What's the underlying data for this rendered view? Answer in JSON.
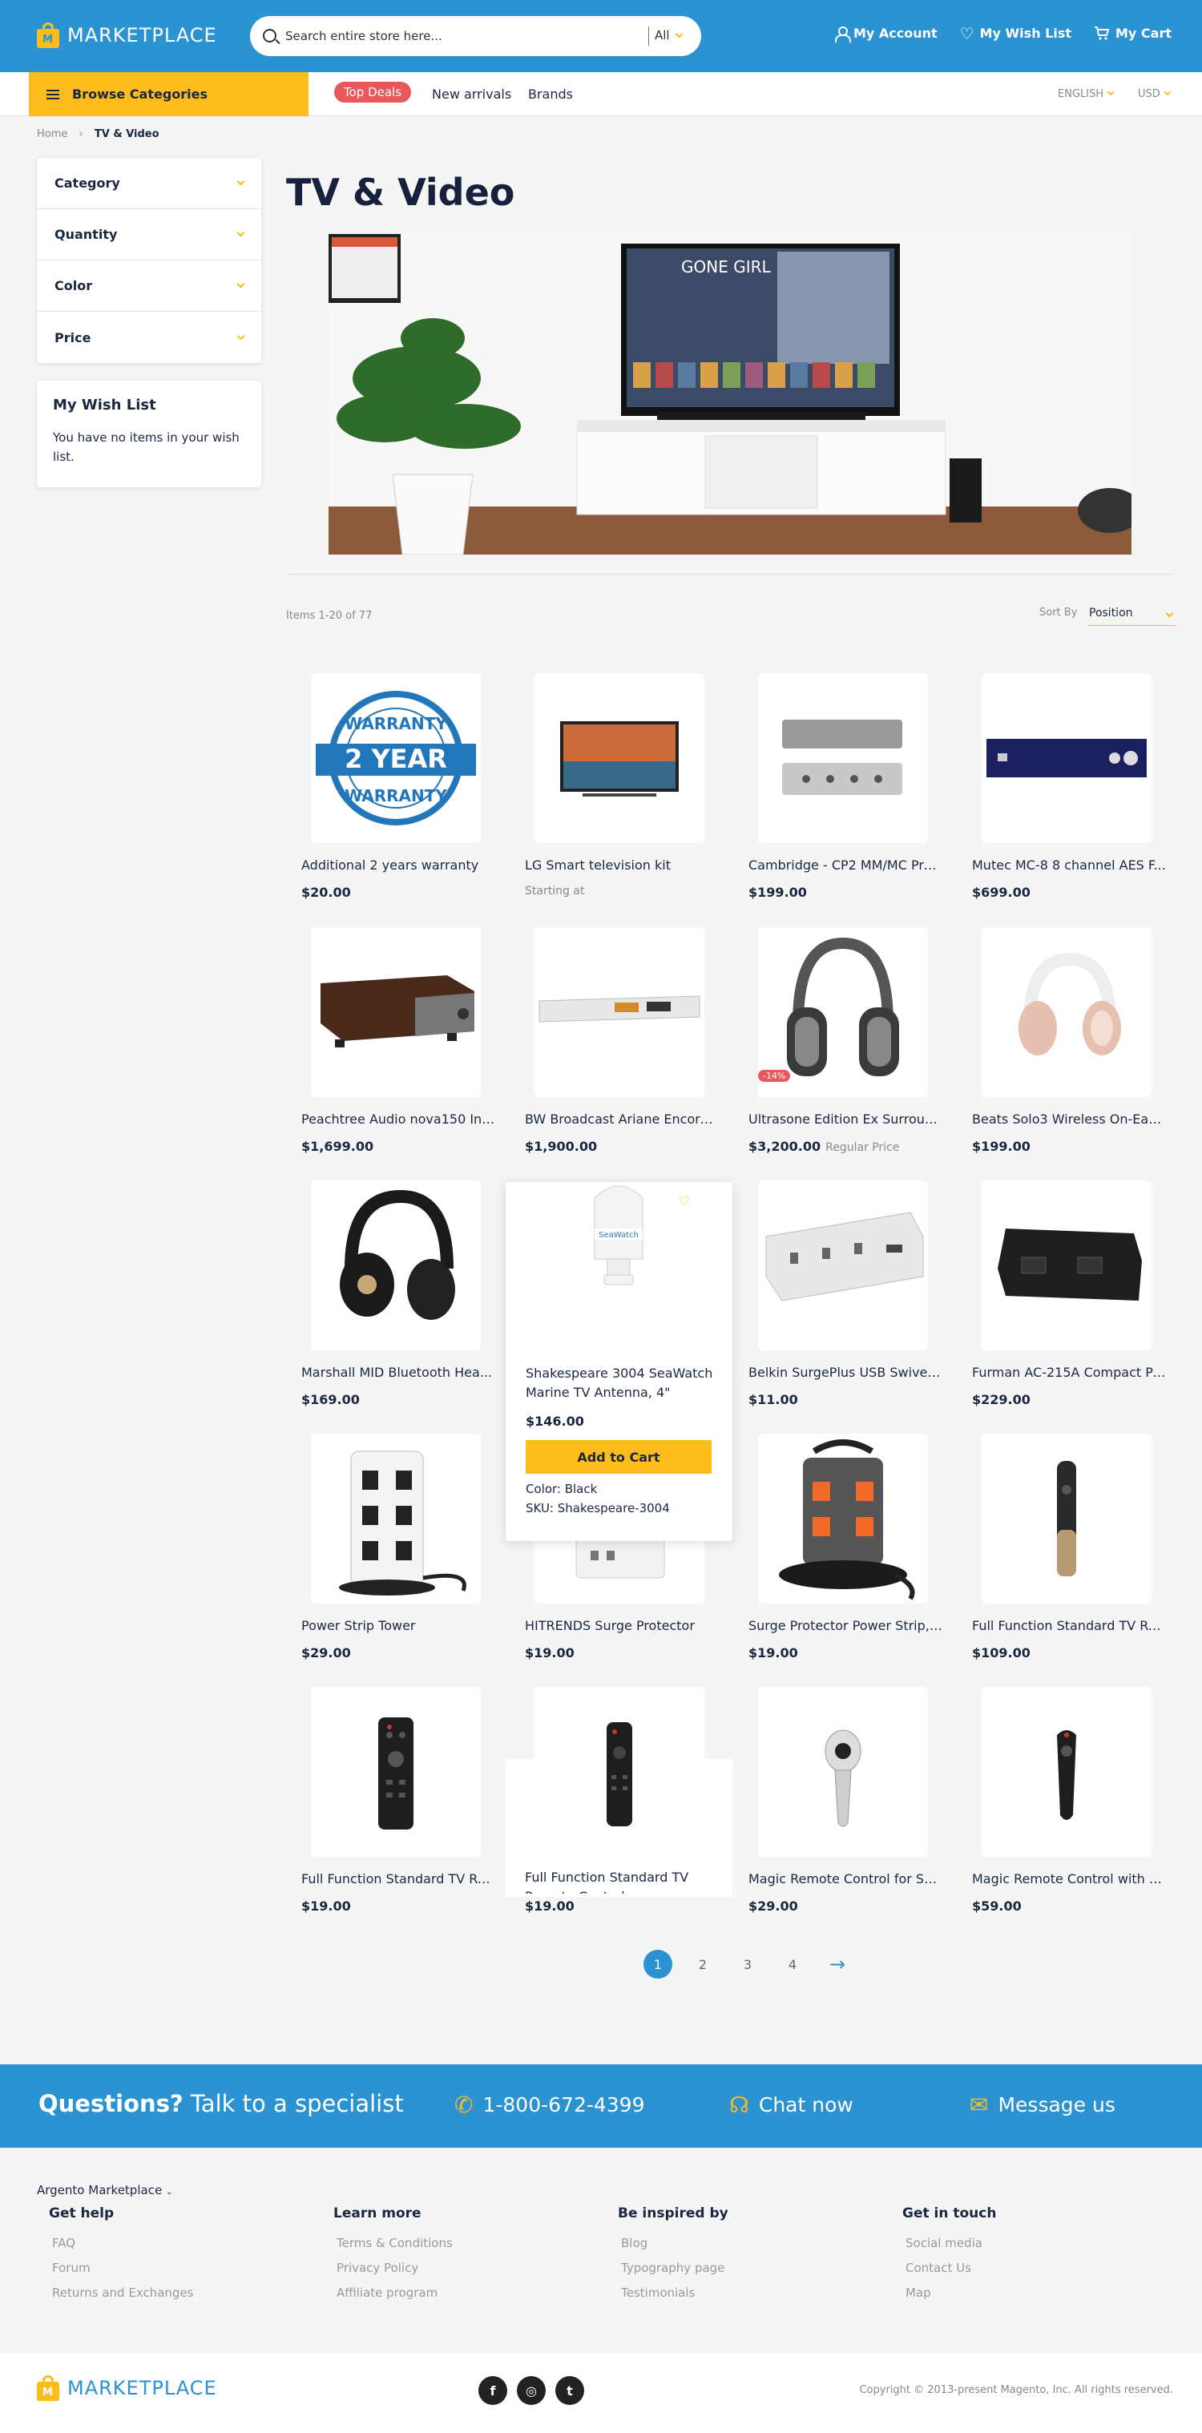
{
  "header": {
    "logo_text": "MARKETPLACE",
    "logo_letter": "M",
    "search_placeholder": "Search entire store here...",
    "search_scope": "All",
    "my_account": "My Account",
    "my_wishlist": "My Wish List",
    "my_cart": "My Cart"
  },
  "nav": {
    "browse": "Browse Categories",
    "top_deals": "Top Deals",
    "new_arrivals": "New arrivals",
    "brands": "Brands",
    "language": "ENGLISH",
    "currency": "USD"
  },
  "breadcrumb": {
    "home": "Home",
    "sep": "›",
    "current": "TV & Video"
  },
  "filters": [
    "Category",
    "Quantity",
    "Color",
    "Price"
  ],
  "wishlist": {
    "title": "My Wish List",
    "empty": "You have no items in your wish list."
  },
  "page_title": "TV & Video",
  "banner": {
    "movie_title": "GONE GIRL"
  },
  "toolbar": {
    "items_count": "Items 1-20 of 77",
    "sort_label": "Sort By",
    "sort_value": "Position"
  },
  "products": [
    {
      "name": "Additional 2 years warranty",
      "price": "$20.00",
      "icon": "warranty-badge"
    },
    {
      "name": "LG Smart television kit",
      "price": "",
      "note": "Starting at",
      "icon": "tv"
    },
    {
      "name": "Cambridge - CP2 MM/MC Pre...",
      "price": "$199.00",
      "icon": "preamp"
    },
    {
      "name": "Mutec MC-8 8 channel AES F...",
      "price": "$699.00",
      "icon": "rack-unit"
    },
    {
      "name": "Peachtree Audio nova150 Int...",
      "price": "$1,699.00",
      "icon": "amplifier"
    },
    {
      "name": "BW Broadcast Ariane Encore ...",
      "price": "$1,900.00",
      "icon": "rack-unit-white"
    },
    {
      "name": "Ultrasone Edition Ex Surroun...",
      "price": "$3,200.00",
      "regular": "Regular Price",
      "badge": "-14%",
      "icon": "headphones"
    },
    {
      "name": "Beats Solo3 Wireless On-Ear ...",
      "price": "$199.00",
      "icon": "headphones-rose"
    },
    {
      "name": "Marshall MID Bluetooth Hea...",
      "price": "$169.00",
      "icon": "headphones-black"
    },
    {
      "name": "Shakespeare 3004 SeaWatch Marine TV Antenna, 4\"",
      "price": "$146.00",
      "icon": "antenna"
    },
    {
      "name": "Belkin SurgePlus USB Swivel ...",
      "price": "$11.00",
      "icon": "surge-protector"
    },
    {
      "name": "Furman AC-215A Compact Po...",
      "price": "$229.00",
      "icon": "power-conditioner"
    },
    {
      "name": "Power Strip Tower",
      "price": "$29.00",
      "icon": "power-tower"
    },
    {
      "name": "HITRENDS Surge Protector",
      "price": "$19.00",
      "icon": "wall-outlet"
    },
    {
      "name": "Surge Protector Power Strip, ...",
      "price": "$19.00",
      "icon": "power-tower-orange"
    },
    {
      "name": "Full Function Standard TV Re...",
      "price": "$109.00",
      "icon": "remote-gold"
    },
    {
      "name": "Full Function Standard TV Re...",
      "price": "$19.00",
      "icon": "remote"
    },
    {
      "name": "Full Function Standard TV Remote Control",
      "price": "$19.00",
      "icon": "remote"
    },
    {
      "name": "Magic Remote Control for SE...",
      "price": "$29.00",
      "icon": "magic-remote"
    },
    {
      "name": "Magic Remote Control with V...",
      "price": "$59.00",
      "icon": "magic-remote-black"
    }
  ],
  "hover_card": {
    "add_to_cart": "Add to Cart",
    "color": "Color: Black",
    "sku": "SKU: Shakespeare-3004"
  },
  "pagination": {
    "pages": [
      "1",
      "2",
      "3",
      "4"
    ],
    "current": "1",
    "next": "→"
  },
  "cta": {
    "question_bold": "Questions?",
    "question_rest": " Talk to a specialist",
    "phone": "1-800-672-4399",
    "chat": "Chat now",
    "message": "Message us"
  },
  "footer": {
    "store_switcher": "Argento Marketplace",
    "columns": [
      {
        "title": "Get help",
        "links": [
          "FAQ",
          "Forum",
          "Returns and Exchanges"
        ]
      },
      {
        "title": "Learn more",
        "links": [
          "Terms & Conditions",
          "Privacy Policy",
          "Affiliate program"
        ]
      },
      {
        "title": "Be inspired by",
        "links": [
          "Blog",
          "Typography page",
          "Testimonials"
        ]
      },
      {
        "title": "Get in touch",
        "links": [
          "Social media",
          "Contact Us",
          "Map"
        ]
      }
    ],
    "social": [
      "f",
      "◎",
      "t"
    ],
    "copyright": "Copyright © 2013-present Magento, Inc. All rights reserved."
  },
  "colors": {
    "primary": "#2b93d1",
    "accent": "#fbbc1c",
    "sale": "#e8585a",
    "text": "#1a2740"
  }
}
